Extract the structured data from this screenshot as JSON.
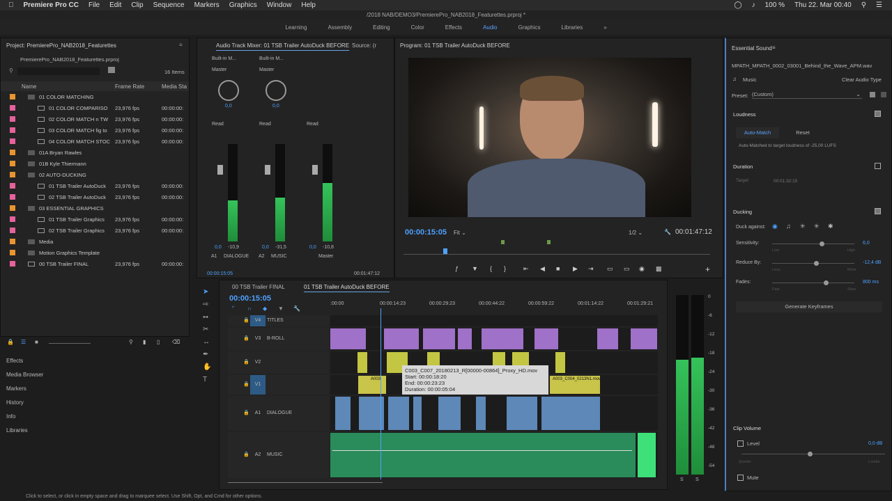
{
  "menubar": {
    "apple_icon": "apple-icon",
    "app_name": "Premiere Pro CC",
    "items": [
      "File",
      "Edit",
      "Clip",
      "Sequence",
      "Markers",
      "Graphics",
      "Window",
      "Help"
    ],
    "battery": "100 %",
    "clock": "Thu 22. Mar  00:40"
  },
  "title": "/2018 NAB/DEMO3/PremierePro_NAB2018_Featurettes.prproj *",
  "workspaces": [
    "Learning",
    "Assembly",
    "Editing",
    "Color",
    "Effects",
    "Audio",
    "Graphics",
    "Libraries"
  ],
  "workspace_active": "Audio",
  "project": {
    "title": "Project: PremierePro_NAB2018_Featurettes",
    "file": "PremierePro_NAB2018_Featurettes.prproj",
    "count": "16 Items",
    "headers": {
      "name": "Name",
      "rate": "Frame Rate",
      "media": "Media Sta"
    },
    "items": [
      {
        "name": "01 COLOR MATCHING",
        "rate": "",
        "tc": "",
        "color": "#e8952f",
        "type": "folder"
      },
      {
        "name": "01 COLOR COMPARISO",
        "rate": "23,976 fps",
        "tc": "00:00:00:",
        "color": "#e5629b",
        "type": "seq"
      },
      {
        "name": "02 COLOR MATCH n TW",
        "rate": "23,976 fps",
        "tc": "00:00:00:",
        "color": "#e5629b",
        "type": "seq"
      },
      {
        "name": "03 COLOR MATCH fig to",
        "rate": "23,976 fps",
        "tc": "00:00:00:",
        "color": "#e5629b",
        "type": "seq"
      },
      {
        "name": "04 COLOR MATCH STOC",
        "rate": "23,976 fps",
        "tc": "00:00:00:",
        "color": "#e5629b",
        "type": "seq"
      },
      {
        "name": "01A Bryan Rawles",
        "rate": "",
        "tc": "",
        "color": "#e8952f",
        "type": "folder"
      },
      {
        "name": "01B Kyle Thiermann",
        "rate": "",
        "tc": "",
        "color": "#e8952f",
        "type": "folder"
      },
      {
        "name": "02 AUTO-DUCKING",
        "rate": "",
        "tc": "",
        "color": "#e8952f",
        "type": "folder"
      },
      {
        "name": "01 TSB Trailer AutoDuck",
        "rate": "23,976 fps",
        "tc": "00:00:00:",
        "color": "#e5629b",
        "type": "seq"
      },
      {
        "name": "02 TSB Trailer AutoDuck",
        "rate": "23,976 fps",
        "tc": "00:00:00:",
        "color": "#e5629b",
        "type": "seq"
      },
      {
        "name": "03 ESSENTIAL GRAPHICS",
        "rate": "",
        "tc": "",
        "color": "#e8952f",
        "type": "folder"
      },
      {
        "name": "01 TSB Trailer Graphics",
        "rate": "23,976 fps",
        "tc": "00:00:00:",
        "color": "#e5629b",
        "type": "seq"
      },
      {
        "name": "02 TSB Trailer Graphics",
        "rate": "23,976 fps",
        "tc": "00:00:00:",
        "color": "#e5629b",
        "type": "seq"
      },
      {
        "name": "Media",
        "rate": "",
        "tc": "",
        "color": "#e8952f",
        "type": "folder"
      },
      {
        "name": "Motion Graphics Template",
        "rate": "",
        "tc": "",
        "color": "#e8952f",
        "type": "folder"
      },
      {
        "name": "00 TSB Trailer FINAL",
        "rate": "23,976 fps",
        "tc": "00:00:00:",
        "color": "#e5629b",
        "type": "seq"
      }
    ]
  },
  "left_panels": [
    "Effects",
    "Media Browser",
    "Markers",
    "History",
    "Info",
    "Libraries"
  ],
  "mixer": {
    "tab": "Audio Track Mixer: 01 TSB Trailer AutoDuck BEFORE",
    "source_tab": "Source: (r",
    "channels": [
      {
        "input": "Built-in M...",
        "output": "Master",
        "pan": "0,0",
        "mode": "Read",
        "vol": "0,0",
        "peak": "-10,9",
        "track": "A1",
        "name": "DIALOGUE",
        "level": 0.42
      },
      {
        "input": "Built-in M...",
        "output": "Master",
        "pan": "0,0",
        "mode": "Read",
        "vol": "0,0",
        "peak": "-31,5",
        "track": "A2",
        "name": "MUSIC",
        "level": 0.45
      },
      {
        "input": "",
        "output": "",
        "pan": "",
        "mode": "Read",
        "vol": "0,0",
        "peak": "-10,8",
        "track": "",
        "name": "Master",
        "level": 0.6
      }
    ],
    "scale": [
      "dB",
      "0",
      "-12",
      "-24",
      "-36",
      "-48"
    ],
    "tc_left": "00:00:15:05",
    "tc_right": "00:01:47:12"
  },
  "program": {
    "title": "Program: 01 TSB Trailer AutoDuck BEFORE",
    "timecode": "00:00:15:05",
    "fit": "Fit",
    "quality": "1/2",
    "duration": "00:01:47:12"
  },
  "timeline": {
    "tabs": [
      "00 TSB Trailer FINAL",
      "01 TSB Trailer AutoDuck BEFORE"
    ],
    "active_tab": "01 TSB Trailer AutoDuck BEFORE",
    "timecode": "00:00:15:05",
    "ruler": [
      ":00:00",
      "00:00:14:23",
      "00:00:29:23",
      "00:00:44:22",
      "00:00:59:22",
      "00:01:14:22",
      "00:01:29:21"
    ],
    "tracks": [
      {
        "id": "V4",
        "name": "TITLES"
      },
      {
        "id": "V3",
        "name": "B-ROLL"
      },
      {
        "id": "V2",
        "name": ""
      },
      {
        "id": "V1",
        "name": ""
      },
      {
        "id": "A1",
        "name": "DIALOGUE"
      },
      {
        "id": "A2",
        "name": "MUSIC"
      }
    ],
    "tooltip": {
      "clip": "C003_C007_20180213_R[00000-00864]_Proxy_HD.mov",
      "start": "Start: 00:00:18:20",
      "end": "End: 00:00:23:23",
      "duration": "Duration: 00:00:05:04"
    },
    "clip_labels": [
      "A003",
      "A003_C004_0213N1.mov"
    ],
    "meter_scale": [
      "0",
      "-6",
      "-12",
      "-18",
      "-24",
      "-30",
      "-36",
      "-42",
      "-48",
      "-54"
    ]
  },
  "essential_sound": {
    "title": "Essential Sound",
    "file": "MPATH_MPATH_0002_03001_Behind_the_Wave_APM.wav",
    "type": "Music",
    "clear": "Clear Audio Type",
    "preset_label": "Preset:",
    "preset": "(Custom)",
    "loudness": "Loudness",
    "auto_match": "Auto-Match",
    "reset": "Reset",
    "auto_note": "Auto-Matched to target loudness of -25,00 LUFS",
    "duration": "Duration",
    "target_label": "Target",
    "target": "00:01:32:15",
    "ducking": "Ducking",
    "duck_against": "Duck against:",
    "sensitivity": {
      "label": "Sensitivity:",
      "low": "Low",
      "high": "High",
      "value": "6,0",
      "pos": 0.6
    },
    "reduce": {
      "label": "Reduce By:",
      "low": "Less",
      "high": "More",
      "value": "-12,4 dB",
      "pos": 0.53
    },
    "fades": {
      "label": "Fades:",
      "low": "Fast",
      "high": "Slow",
      "value": "800 ms",
      "pos": 0.65
    },
    "generate": "Generate Keyframes",
    "clip_volume": "Clip Volume",
    "level": "Level",
    "level_value": "0,0 dB",
    "quieter": "Quieter",
    "louder": "Louder",
    "mute": "Mute"
  },
  "status": "Click to select, or click in empty space and drag to marquee select. Use Shift, Opt, and Cmd for other options."
}
